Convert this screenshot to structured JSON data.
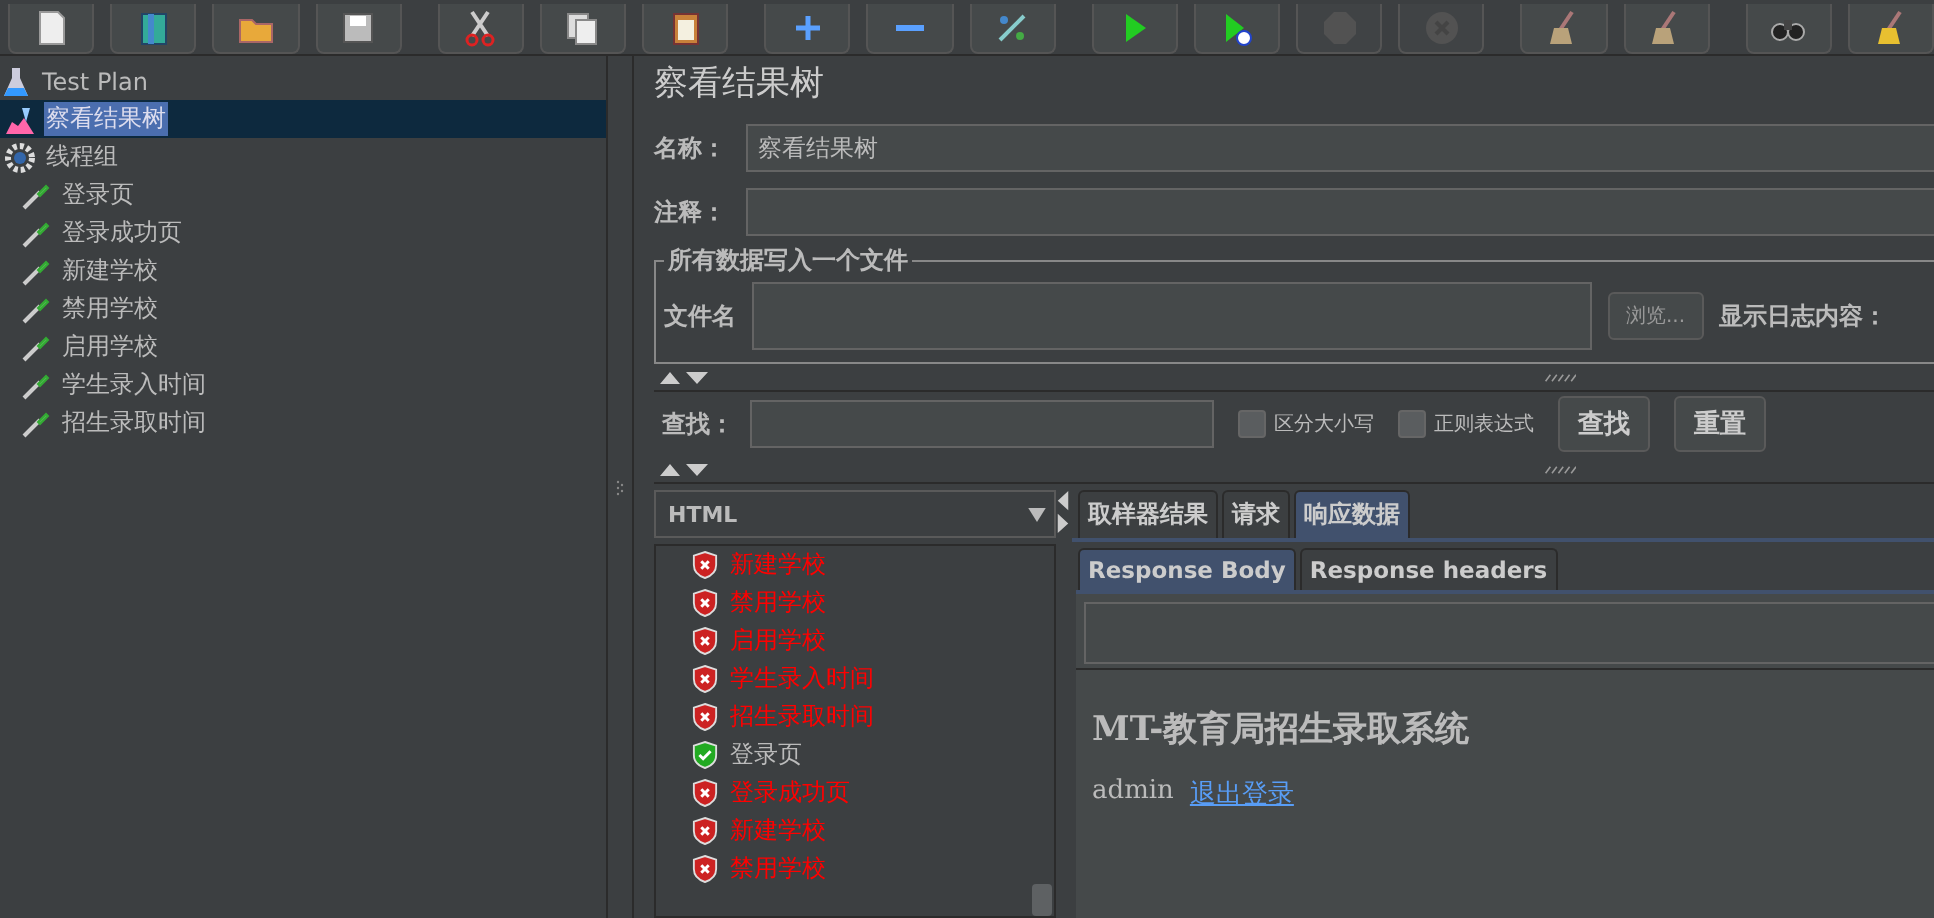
{
  "toolbar": [
    {
      "kind": "new",
      "disabled": false,
      "group_start": false
    },
    {
      "kind": "template",
      "disabled": false,
      "group_start": false
    },
    {
      "kind": "open",
      "disabled": false,
      "group_start": false
    },
    {
      "kind": "save",
      "disabled": false,
      "group_start": false
    },
    {
      "kind": "cut",
      "disabled": false,
      "group_start": true
    },
    {
      "kind": "copy",
      "disabled": false,
      "group_start": false
    },
    {
      "kind": "paste",
      "disabled": false,
      "group_start": false
    },
    {
      "kind": "add",
      "disabled": false,
      "group_start": true
    },
    {
      "kind": "remove",
      "disabled": false,
      "group_start": false
    },
    {
      "kind": "toggle",
      "disabled": false,
      "group_start": false
    },
    {
      "kind": "start",
      "disabled": false,
      "group_start": true
    },
    {
      "kind": "start-no-pause",
      "disabled": false,
      "group_start": false
    },
    {
      "kind": "stop",
      "disabled": true,
      "group_start": false
    },
    {
      "kind": "shutdown",
      "disabled": true,
      "group_start": false
    },
    {
      "kind": "clear",
      "disabled": false,
      "group_start": true
    },
    {
      "kind": "clear-all",
      "disabled": false,
      "group_start": false
    },
    {
      "kind": "search",
      "disabled": false,
      "group_start": true
    },
    {
      "kind": "reset-search",
      "disabled": false,
      "group_start": false
    }
  ],
  "tree": {
    "label": "Test Plan",
    "kind": "plan",
    "selected": false,
    "children": [
      {
        "label": "察看结果树",
        "kind": "listener",
        "selected": true
      },
      {
        "label": "线程组",
        "kind": "thread-group",
        "selected": false,
        "children": [
          {
            "label": "登录页",
            "kind": "sampler",
            "selected": false
          },
          {
            "label": "登录成功页",
            "kind": "sampler",
            "selected": false
          },
          {
            "label": "新建学校",
            "kind": "sampler",
            "selected": false
          },
          {
            "label": "禁用学校",
            "kind": "sampler",
            "selected": false
          },
          {
            "label": "启用学校",
            "kind": "sampler",
            "selected": false
          },
          {
            "label": "学生录入时间",
            "kind": "sampler",
            "selected": false
          },
          {
            "label": "招生录取时间",
            "kind": "sampler",
            "selected": false
          }
        ]
      }
    ]
  },
  "panel": {
    "title": "察看结果树",
    "name_label": "名称：",
    "name_value": "察看结果树",
    "comment_label": "注释：",
    "file_group": {
      "legend": "所有数据写入一个文件",
      "file_label": "文件名",
      "browse_button": "浏览...",
      "log_label": "显示日志内容："
    },
    "search": {
      "label": "查找：",
      "options": [
        {
          "label": "区分大小写",
          "checked": false
        },
        {
          "label": "正则表达式",
          "checked": false
        }
      ],
      "find_button": "查找",
      "reset_button": "重置"
    },
    "renderer": "HTML",
    "results": [
      {
        "label": "新建学校",
        "success": false
      },
      {
        "label": "禁用学校",
        "success": false
      },
      {
        "label": "启用学校",
        "success": false
      },
      {
        "label": "学生录入时间",
        "success": false
      },
      {
        "label": "招生录取时间",
        "success": false
      },
      {
        "label": "登录页",
        "success": true
      },
      {
        "label": "登录成功页",
        "success": false
      },
      {
        "label": "新建学校",
        "success": false
      },
      {
        "label": "禁用学校",
        "success": false
      }
    ],
    "tabs": [
      {
        "label": "取样器结果",
        "selected": false
      },
      {
        "label": "请求",
        "selected": false
      },
      {
        "label": "响应数据",
        "selected": true
      }
    ],
    "subtabs": [
      {
        "label": "Response Body",
        "selected": true
      },
      {
        "label": "Response headers",
        "selected": false
      }
    ],
    "response": {
      "heading": "MT-教育局招生录取系统",
      "user": "admin",
      "logout_link": "退出登录"
    }
  }
}
